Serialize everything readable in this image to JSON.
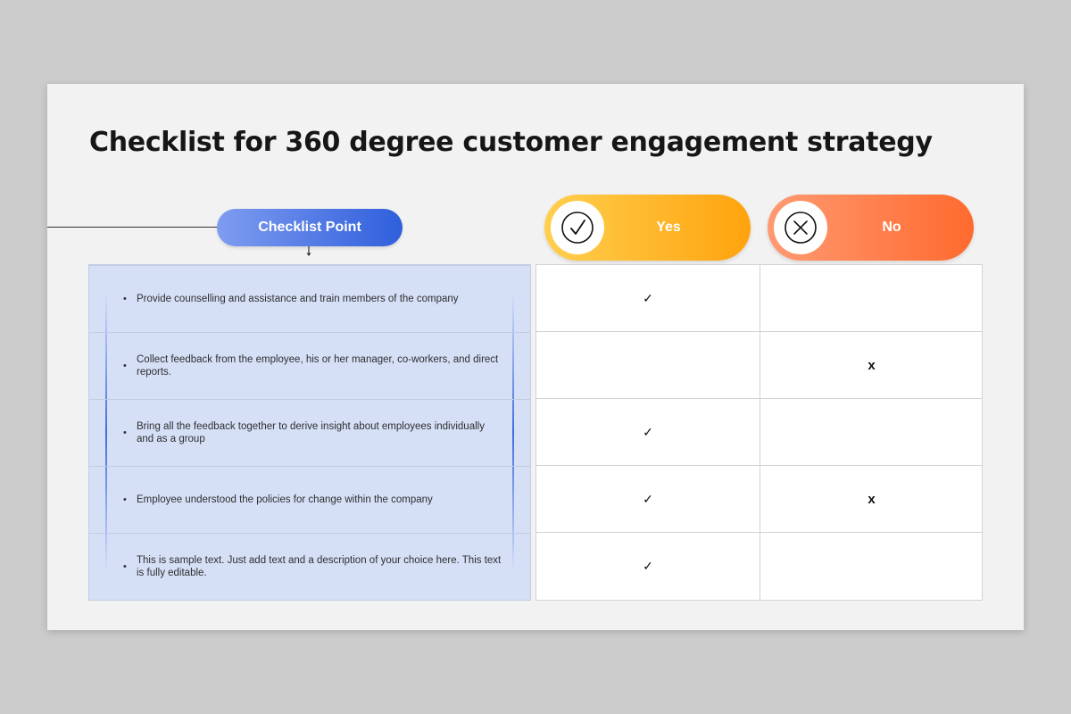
{
  "title": "Checklist for 360 degree customer engagement strategy",
  "header": {
    "checklist_label": "Checklist Point",
    "yes_label": "Yes",
    "no_label": "No",
    "yes_color": "#ffa30d",
    "no_color": "#ff6a2e",
    "checklist_color": "#2f5fdc"
  },
  "rows": [
    {
      "text": "Provide counselling and assistance and train members of the company",
      "yes": "✓",
      "no": ""
    },
    {
      "text": "Collect feedback from the employee, his or her manager, co-workers, and direct reports.",
      "yes": "",
      "no": "x"
    },
    {
      "text": "Bring all the feedback together to derive insight about employees individually and as a group",
      "yes": "✓",
      "no": ""
    },
    {
      "text": "Employee understood the policies for change within the company",
      "yes": "✓",
      "no": "x"
    },
    {
      "text": "This is sample text. Just add text and a description of your choice here. This text is fully editable.",
      "yes": "✓",
      "no": ""
    }
  ],
  "icons": {
    "yes_icon": "check-circle-icon",
    "no_icon": "x-circle-icon"
  }
}
